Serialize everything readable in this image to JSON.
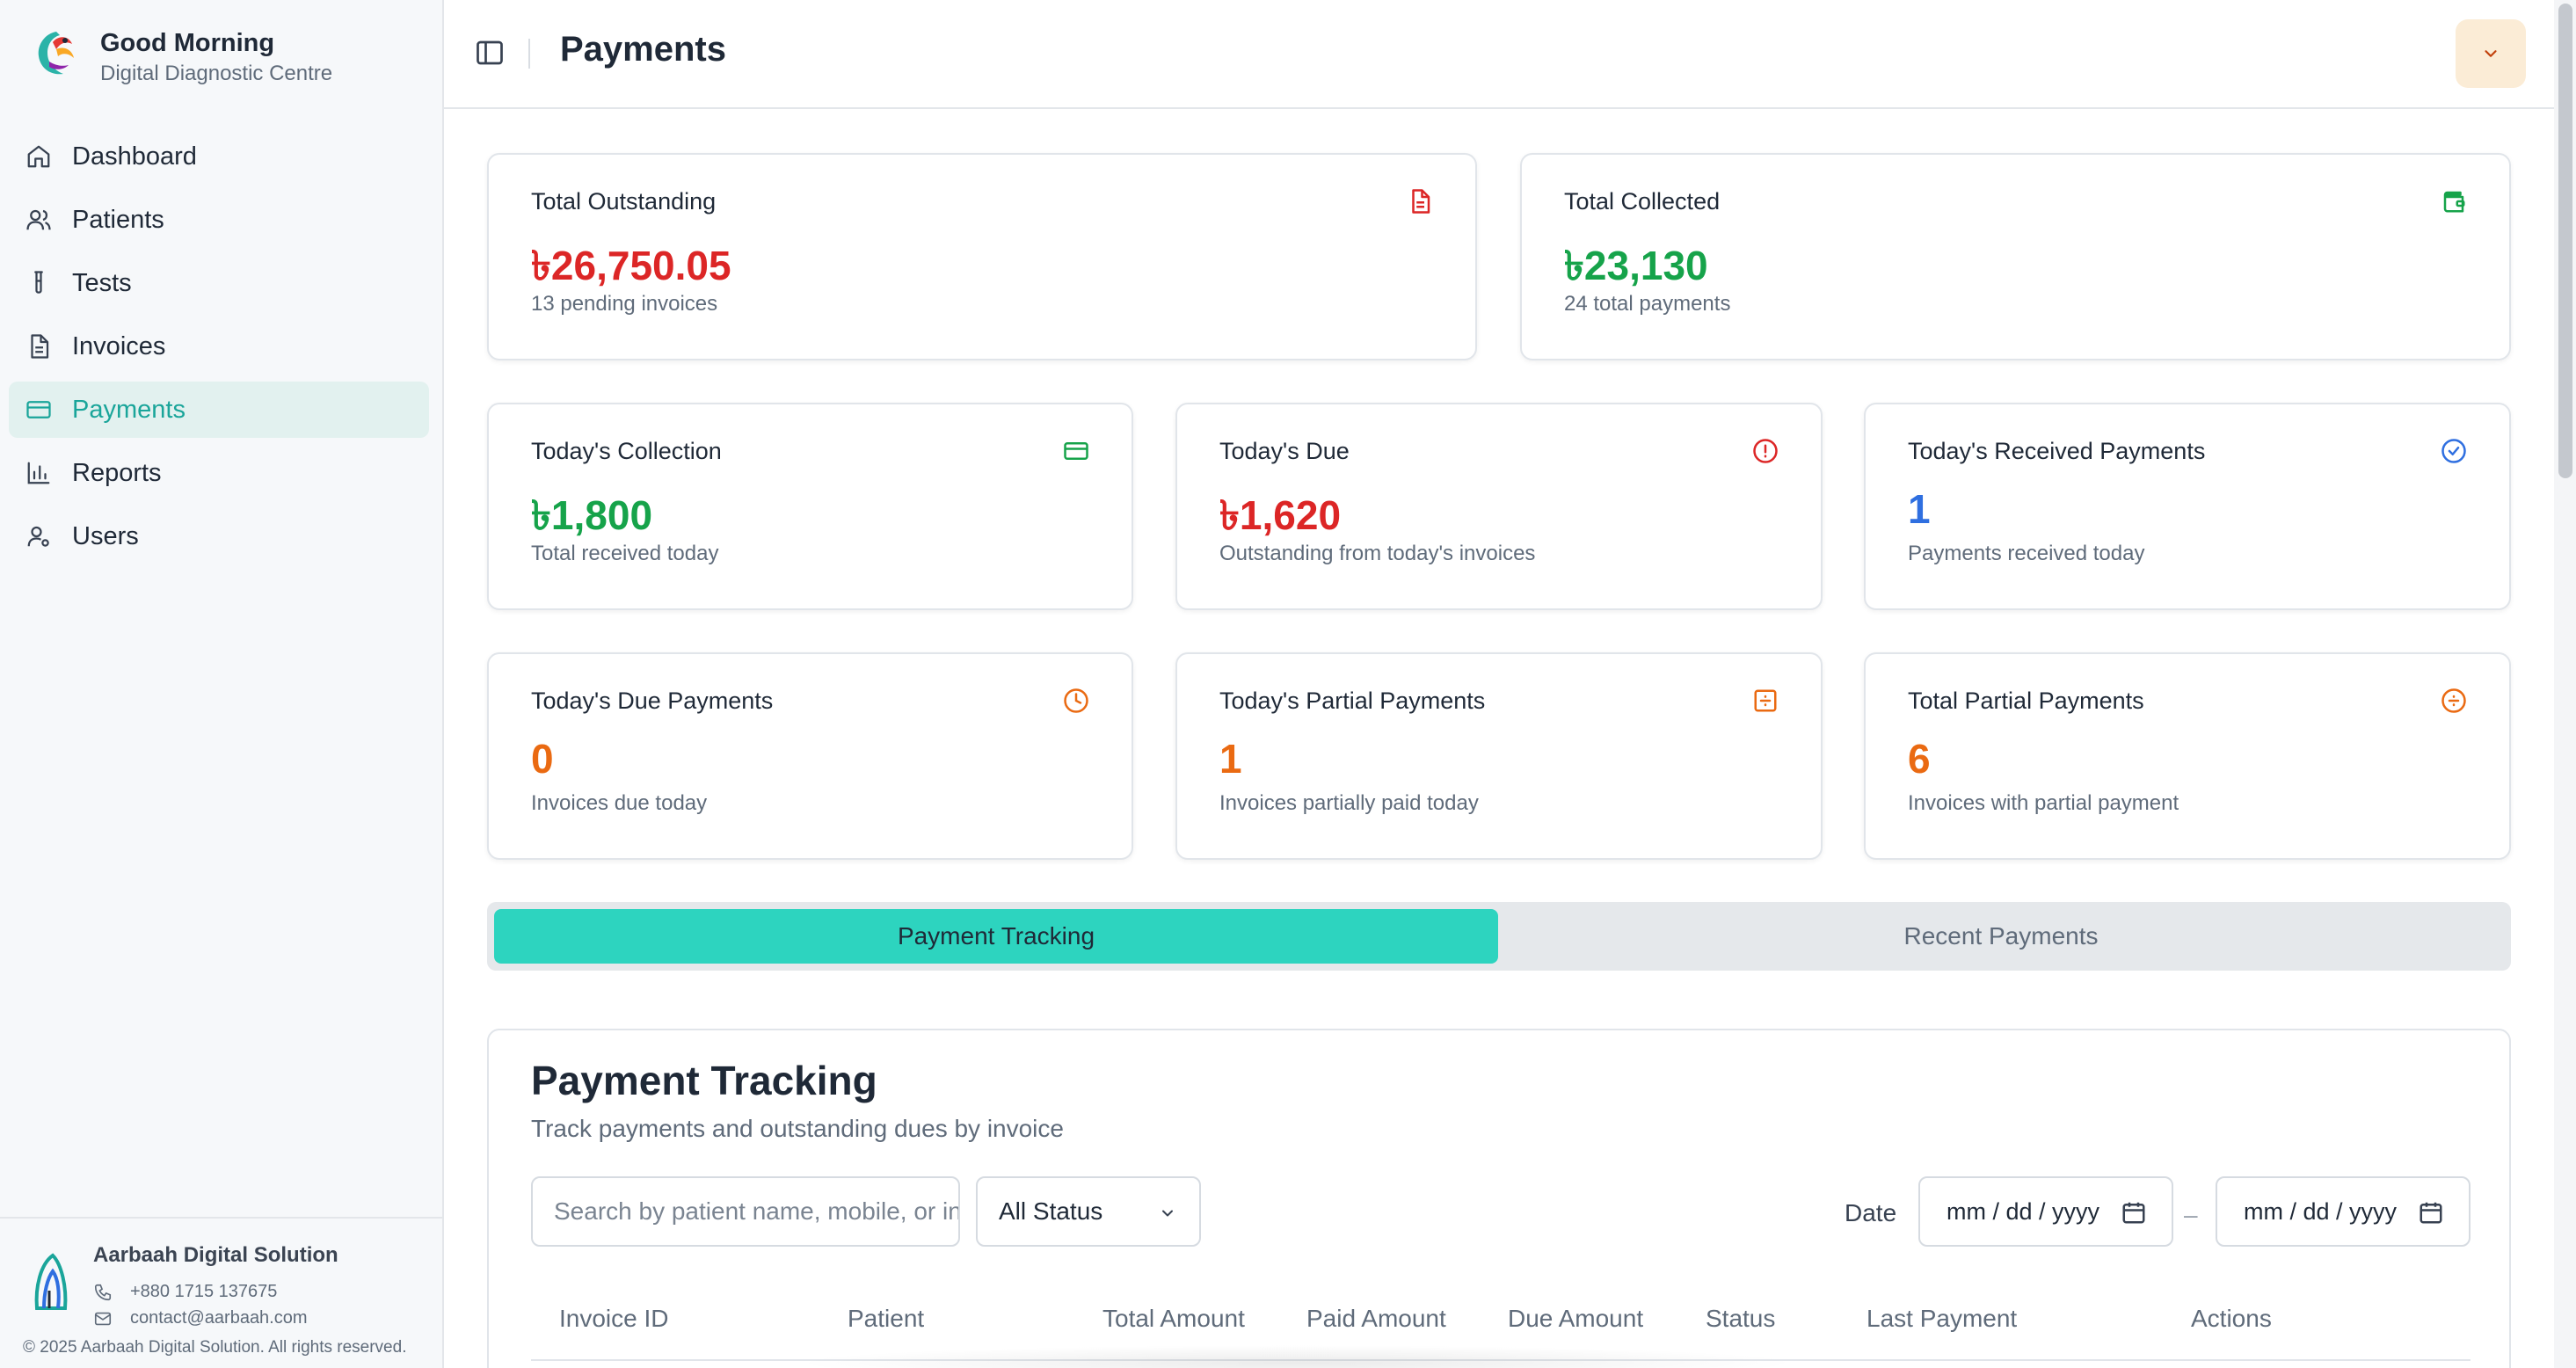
{
  "brand": {
    "title": "Good Morning",
    "subtitle": "Digital Diagnostic Centre"
  },
  "nav": [
    {
      "label": "Dashboard",
      "icon": "home-icon"
    },
    {
      "label": "Patients",
      "icon": "users-icon"
    },
    {
      "label": "Tests",
      "icon": "test-tube-icon"
    },
    {
      "label": "Invoices",
      "icon": "file-text-icon"
    },
    {
      "label": "Payments",
      "icon": "credit-card-icon",
      "active": true
    },
    {
      "label": "Reports",
      "icon": "bar-chart-icon"
    },
    {
      "label": "Users",
      "icon": "user-cog-icon"
    }
  ],
  "footer": {
    "company": "Aarbaah Digital Solution",
    "phone": "+880 1715 137675",
    "email": "contact@aarbaah.com",
    "copyright": "© 2025 Aarbaah Digital Solution. All rights reserved."
  },
  "header": {
    "title": "Payments"
  },
  "cards": {
    "total_outstanding": {
      "title": "Total Outstanding",
      "value": "৳26,750.05",
      "sub": "13 pending invoices",
      "icon": "file-icon",
      "color": "#dc2626"
    },
    "total_collected": {
      "title": "Total Collected",
      "value": "৳23,130",
      "sub": "24 total payments",
      "icon": "wallet-icon",
      "color": "#16a34a"
    },
    "todays_collection": {
      "title": "Today's Collection",
      "value": "৳1,800",
      "sub": "Total received today",
      "icon": "credit-card-icon",
      "color": "#16a34a"
    },
    "todays_due": {
      "title": "Today's Due",
      "value": "৳1,620",
      "sub": "Outstanding from today's invoices",
      "icon": "alert-circle-icon",
      "color": "#dc2626"
    },
    "todays_received": {
      "title": "Today's Received Payments",
      "value": "1",
      "sub": "Payments received today",
      "icon": "check-circle-icon",
      "color": "#2f6fe0"
    },
    "todays_due_payments": {
      "title": "Today's Due Payments",
      "value": "0",
      "sub": "Invoices due today",
      "icon": "clock-icon",
      "color": "#ea6a12"
    },
    "todays_partial": {
      "title": "Today's Partial Payments",
      "value": "1",
      "sub": "Invoices partially paid today",
      "icon": "receipt-icon",
      "color": "#ea6a12"
    },
    "total_partial": {
      "title": "Total Partial Payments",
      "value": "6",
      "sub": "Invoices with partial payment",
      "icon": "divide-circle-icon",
      "color": "#ea6a12"
    }
  },
  "tabs": [
    {
      "label": "Payment Tracking",
      "active": true
    },
    {
      "label": "Recent Payments",
      "active": false
    }
  ],
  "tracking": {
    "title": "Payment Tracking",
    "subtitle": "Track payments and outstanding dues by invoice",
    "search_placeholder": "Search by patient name, mobile, or invoice ID",
    "status_value": "All Status",
    "date_label": "Date",
    "date_from": "mm / dd / yyyy",
    "date_to": "mm / dd / yyyy",
    "separator": "–",
    "columns": [
      "Invoice ID",
      "Patient",
      "Total Amount",
      "Paid Amount",
      "Due Amount",
      "Status",
      "Last Payment",
      "Actions"
    ]
  }
}
